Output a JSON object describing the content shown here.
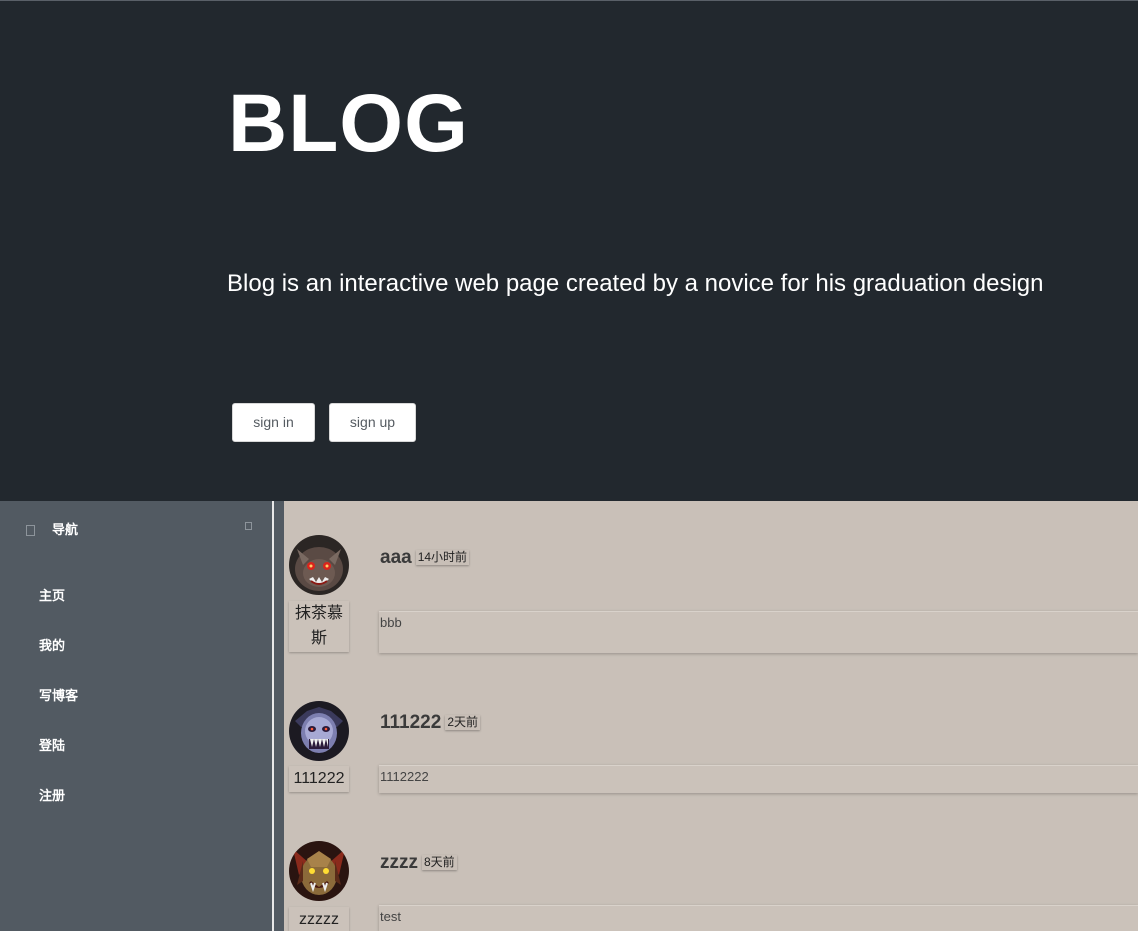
{
  "hero": {
    "title": "BLOG",
    "subtitle": "Blog is an interactive web page created by a novice for his graduation design",
    "signin_label": "sign in",
    "signup_label": "sign up"
  },
  "sidebar": {
    "title": "导航",
    "items": [
      {
        "label": "主页"
      },
      {
        "label": "我的"
      },
      {
        "label": "写博客"
      },
      {
        "label": "登陆"
      },
      {
        "label": "注册"
      }
    ]
  },
  "posts": [
    {
      "author": "抹茶慕斯",
      "title": "aaa",
      "time": "14小时前",
      "body": "bbb",
      "avatar_icon": "red-eyed-beast-avatar-icon"
    },
    {
      "author": "111222",
      "title": "111222",
      "time": "2天前",
      "body": "1112222",
      "avatar_icon": "skull-warrior-avatar-icon"
    },
    {
      "author": "zzzzz",
      "title": "zzzz",
      "time": "8天前",
      "body": "test",
      "avatar_icon": "orc-warrior-avatar-icon"
    }
  ],
  "colors": {
    "hero_bg": "#22282e",
    "sidebar_bg": "#525a62",
    "content_bg": "#c9c0b8"
  }
}
